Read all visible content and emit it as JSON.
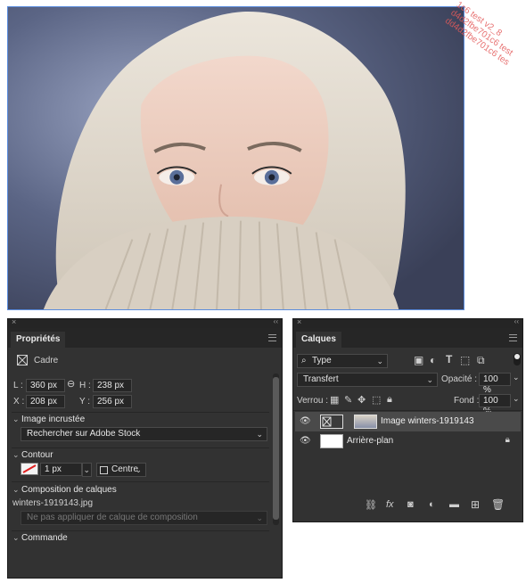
{
  "watermark": "1c6 test v2_8\nd4d2fbe701c6 test\ndd4d2fbe701c6 tes",
  "properties": {
    "tab": "Propriétés",
    "kind_label": "Cadre",
    "w_label": "L :",
    "w_value": "360 px",
    "h_label": "H :",
    "h_value": "238 px",
    "x_label": "X :",
    "x_value": "208 px",
    "y_label": "Y :",
    "y_value": "256 px",
    "embedded_heading": "Image incrustée",
    "embedded_dropdown": "Rechercher sur Adobe Stock",
    "stroke_heading": "Contour",
    "stroke_width": "1 px",
    "stroke_align": "Centre",
    "comps_heading": "Composition de calques",
    "comps_filename": "winters-1919143.jpg",
    "comps_dropdown": "Ne pas appliquer de calque de composition",
    "command_heading": "Commande"
  },
  "layers": {
    "tab": "Calques",
    "filter_kind": "Type",
    "blend_mode": "Transfert",
    "opacity_label": "Opacité :",
    "opacity_value": "100 %",
    "lock_label": "Verrou :",
    "fill_label": "Fond :",
    "fill_value": "100 %",
    "items": [
      {
        "name": "Image winters-1919143"
      },
      {
        "name": "Arrière-plan"
      }
    ]
  },
  "colors": {
    "panel_bg": "#323232",
    "selection_border": "#5b8dde",
    "stroke_swatch": "#e02020"
  }
}
